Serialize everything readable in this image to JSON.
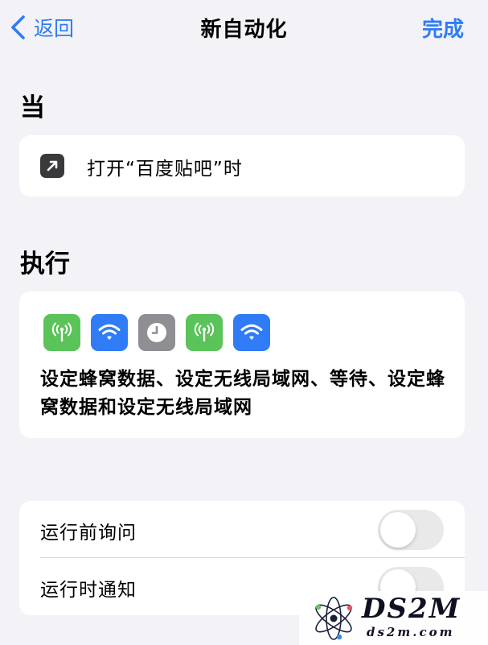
{
  "nav": {
    "back_label": "返回",
    "title": "新自动化",
    "done_label": "完成"
  },
  "trigger_section": {
    "header": "当",
    "item_label": "打开“百度贴吧”时",
    "icon": "arrow-up-right-icon"
  },
  "action_section": {
    "header": "执行",
    "icons": [
      {
        "name": "cellular-icon",
        "color": "#5ac35a"
      },
      {
        "name": "wifi-icon",
        "color": "#2f7cf6"
      },
      {
        "name": "clock-icon",
        "color": "#8e8e93"
      },
      {
        "name": "cellular-icon",
        "color": "#5ac35a"
      },
      {
        "name": "wifi-icon",
        "color": "#2f7cf6"
      }
    ],
    "summary": "设定蜂窝数据、设定无线局域网、等待、设定蜂窝数据和设定无线局域网"
  },
  "settings": {
    "ask_before_running": {
      "label": "运行前询问",
      "enabled": false
    },
    "notify_when_run": {
      "label": "运行时通知",
      "enabled": false
    }
  },
  "watermark": {
    "brand": "DS2M",
    "url": "ds2m.com"
  },
  "colors": {
    "accent": "#2f7cf6",
    "background": "#f2f2f7",
    "card": "#ffffff",
    "toggle_off": "#e9e9ea"
  }
}
